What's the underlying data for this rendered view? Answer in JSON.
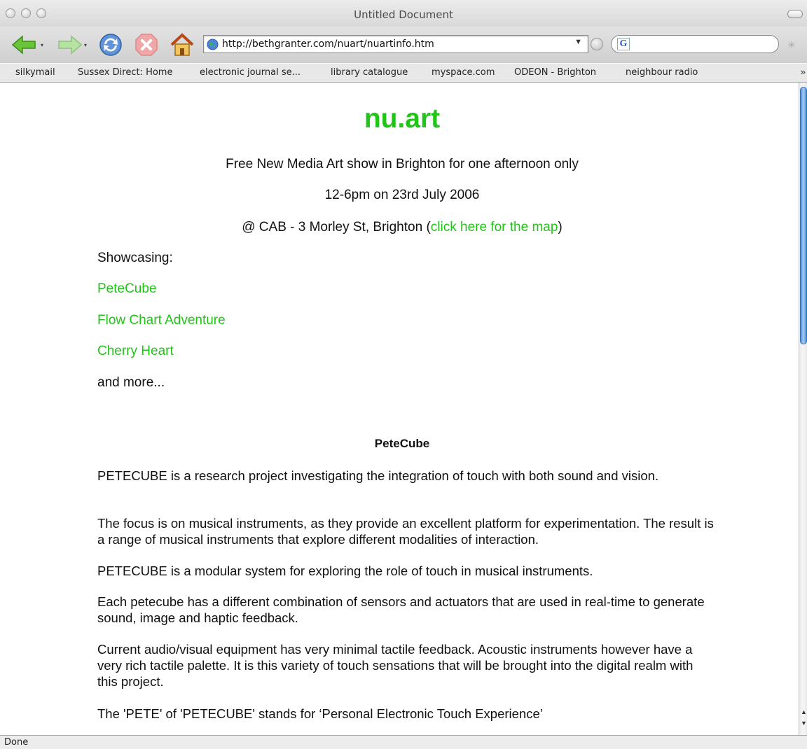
{
  "window": {
    "title": "Untitled Document"
  },
  "toolbar": {
    "url": "http://bethgranter.com/nuart/nuartinfo.htm",
    "search_engine_letter": "G"
  },
  "bookmarks": [
    "silkymail",
    "Sussex Direct: Home",
    "electronic journal se...",
    "library catalogue",
    "myspace.com",
    "ODEON - Brighton",
    "neighbour radio"
  ],
  "bookmarks_more": "»",
  "page": {
    "title": "nu.art",
    "tagline": "Free New Media Art show in Brighton for one afternoon only",
    "datetime": "12-6pm on 23rd July 2006",
    "venue_prefix": "@ CAB - 3 Morley St, Brighton (",
    "venue_link": "click here for the map",
    "venue_suffix": ")",
    "showcasing_label": "Showcasing:",
    "showcase_links": [
      "PeteCube",
      "Flow Chart Adventure",
      "Cherry Heart"
    ],
    "and_more": "and more...",
    "section_heading": "PeteCube",
    "paragraphs": [
      "PETECUBE is a research project investigating the integration of touch with both sound and vision.",
      "The focus is on musical instruments, as they provide an excellent platform for experimentation. The result is a range of musical instruments that explore different modalities of interaction.",
      "PETECUBE is a modular system for exploring the role of touch in musical instruments.",
      "Each petecube has a different combination of sensors and actuators that are used in real-time to generate sound, image and haptic feedback.",
      "Current audio/visual equipment has very minimal tactile feedback. Acoustic instruments however have a very rich tactile palette. It is this variety of touch sensations that will be brought into the digital realm with this project.",
      "The 'PETE' of 'PETECUBE' stands for ‘Personal Electronic Touch Experience’"
    ]
  },
  "status": {
    "text": "Done"
  },
  "colors": {
    "link": "#22c41a",
    "text": "#111111",
    "scroll_thumb": "#4c8fd6"
  }
}
